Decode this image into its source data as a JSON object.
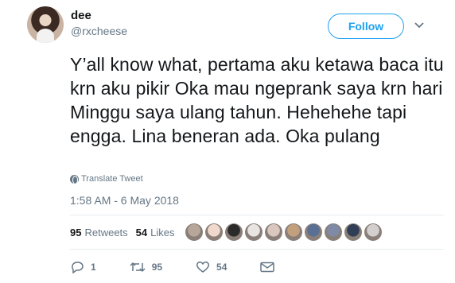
{
  "user": {
    "display_name": "dee",
    "handle": "@rxcheese"
  },
  "follow_label": "Follow",
  "tweet": {
    "text": "Y’all know what, pertama aku ketawa baca itu krn aku pikir Oka mau ngeprank saya krn hari Minggu saya ulang tahun. Hehehehe tapi engga. Lina beneran ada. Oka pulang",
    "translate_label": "Translate Tweet",
    "timestamp": "1:58 AM - 6 May 2018"
  },
  "stats": {
    "retweets_count": "95",
    "retweets_label": "Retweets",
    "likes_count": "54",
    "likes_label": "Likes"
  },
  "likers": [
    "#b7a79a",
    "#f0d9cc",
    "#2a2a2a",
    "#e8e4e1",
    "#d9c7c0",
    "#c3a07d",
    "#5a6f94",
    "#7e8aa6",
    "#2f3e55",
    "#d3cfcf"
  ],
  "actions": {
    "reply_count": "1",
    "retweet_count": "95",
    "like_count": "54"
  },
  "colors": {
    "accent": "#1da1f2",
    "muted": "#657786",
    "text": "#14171a"
  },
  "icons": [
    "caret-down-icon",
    "globe-icon",
    "reply-icon",
    "retweet-icon",
    "heart-icon",
    "envelope-icon"
  ]
}
